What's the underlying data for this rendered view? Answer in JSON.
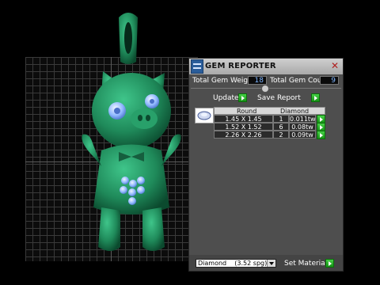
{
  "panel": {
    "title": "GEM REPORTER",
    "close_glyph": "✕",
    "total_weight_label": "Total Gem Weight",
    "total_weight_value": "18",
    "total_count_label": "Total Gem Count",
    "total_count_value": "9",
    "update_label": "Update",
    "save_report_label": "Save Report",
    "table": {
      "headers": [
        "Round",
        "Diamond"
      ],
      "rows": [
        {
          "size": "1.45 X 1.45",
          "count": "1",
          "weight": "0.011tw"
        },
        {
          "size": "1.52 X 1.52",
          "count": "6",
          "weight": "0.08tw"
        },
        {
          "size": "2.26 X 2.26",
          "count": "2",
          "weight": "0.09tw"
        }
      ]
    },
    "material_select": "Diamond    (3.52 spg)",
    "set_material_label": "Set Material"
  },
  "icons": {
    "logo": "gem-reporter-logo-icon",
    "close": "close-icon",
    "gem_thumbnail": "round-gem-icon",
    "go": "green-arrow-icon",
    "dropdown": "chevron-down-icon"
  },
  "colors": {
    "model": "#1f8a5a",
    "gem": "#8fb8ff",
    "go_button": "#2ab52a",
    "value_text": "#7fb6ff"
  }
}
